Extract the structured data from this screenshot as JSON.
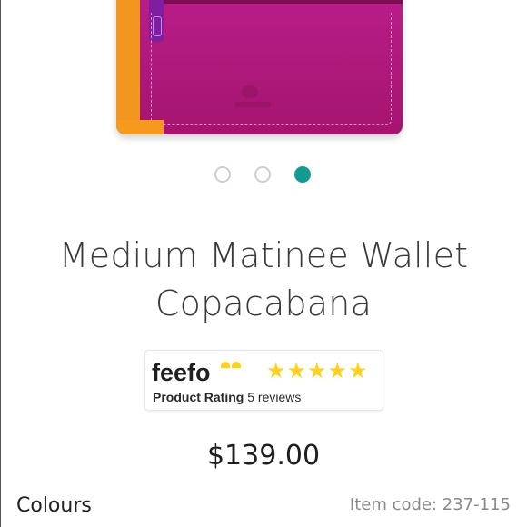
{
  "carousel": {
    "slide_count": 3,
    "active_index": 2,
    "active_color": "#139b92"
  },
  "product": {
    "title_line1": "Medium Matinee Wallet",
    "title_line2": "Copacabana",
    "price": "$139.00",
    "item_code": "Item code: 237-115"
  },
  "rating": {
    "brand": "feefo",
    "stars": "★★★★★",
    "label": "Product Rating",
    "reviews": "5 reviews",
    "star_value": 5,
    "star_color": "#ffd11a"
  },
  "sections": {
    "colours_label": "Colours"
  }
}
